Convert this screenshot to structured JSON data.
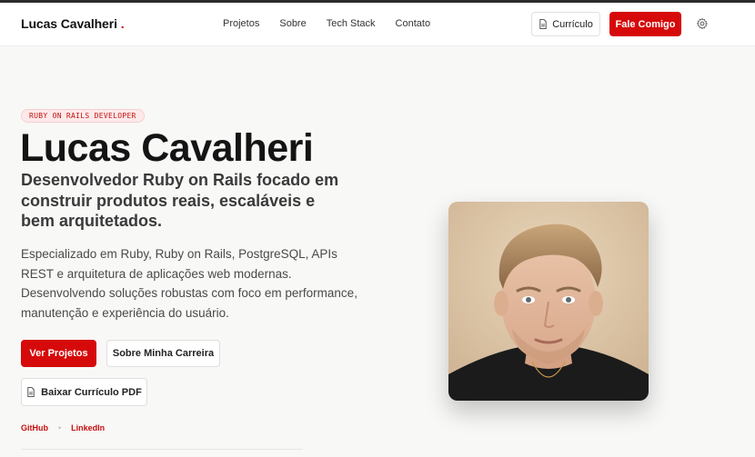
{
  "header": {
    "brand": "Lucas Cavalheri",
    "brand_dot": ".",
    "nav": [
      "Projetos",
      "Sobre",
      "Tech Stack",
      "Contato"
    ],
    "cv_label": "Currículo",
    "contact_label": "Fale Comigo"
  },
  "hero": {
    "badge": "RUBY ON RAILS DEVELOPER",
    "name": "Lucas Cavalheri",
    "subtitle": "Desenvolvedor Ruby on Rails focado em construir produtos reais, escaláveis e bem arquitetados.",
    "description": "Especializado em Ruby, Ruby on Rails, PostgreSQL, APIs REST e arquitetura de aplicações web modernas. Desenvolvendo soluções robustas com foco em performance, manutenção e experiência do usuário.",
    "buttons": {
      "projects": "Ver Projetos",
      "career": "Sobre Minha Carreira",
      "pdf": "Baixar Currículo PDF"
    },
    "social": {
      "github": "GitHub",
      "separator": "•",
      "linkedin": "LinkedIn"
    }
  },
  "colors": {
    "accent": "#d60a0a",
    "background": "#f8f8f7",
    "text": "#141414"
  },
  "icons": {
    "cv": "document-icon",
    "pdf": "document-icon",
    "settings": "gear-icon"
  }
}
